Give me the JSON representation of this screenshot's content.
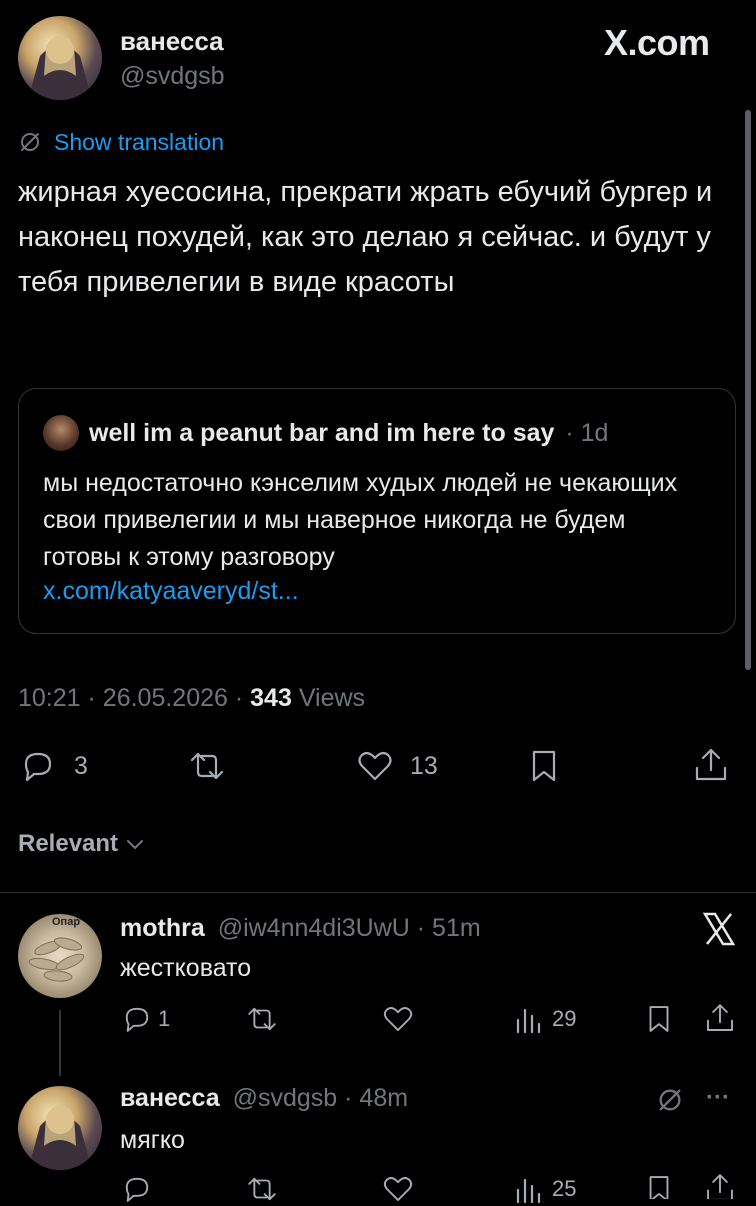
{
  "brand": {
    "site": "X.com"
  },
  "main_post": {
    "author_name": "ванесса",
    "handle": "@svdgsb",
    "translate_label": "Show translation",
    "text": "жирная хуесосина, прекрати жрать ебучий бургер и наконец похудей, как это делаю я сейчас. и будут у тебя привелегии в виде красоты",
    "quote": {
      "author_name": "well im a peanut bar and im here to say",
      "time": "· 1d",
      "text": "мы недостаточно кэнселим худых людей не чекающих свои привелегии и мы наверное никогда не будем готовы к этому разговору",
      "link": "x.com/katyaaveryd/st..."
    },
    "time": "10:21",
    "date": "· 26.05.2026 ·",
    "views_count": "343",
    "views_label": "Views",
    "reply_count": "3",
    "like_count": "13"
  },
  "sort": {
    "label": "Relevant"
  },
  "replies": [
    {
      "author_name": "mothra",
      "handle": "@iw4nn4di3UwU",
      "time": "· 51m",
      "text": "жестковато",
      "avatar_label": "Опар",
      "reply_count": "1",
      "views_count": "29"
    },
    {
      "author_name": "ванесса",
      "handle": "@svdgsb",
      "time": "· 48m",
      "text": "мягко",
      "views_count": "25",
      "more_label": "···"
    }
  ]
}
